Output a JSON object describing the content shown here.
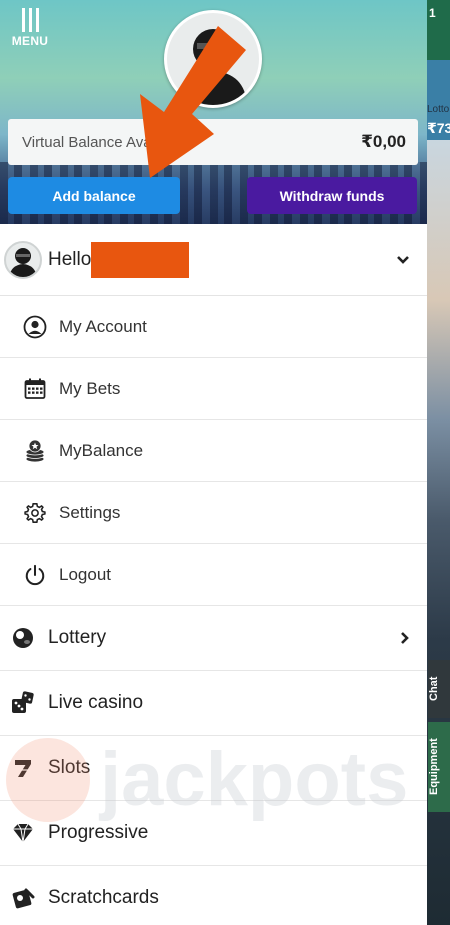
{
  "header": {
    "menu_label": "MENU",
    "balance_label": "Virtual Balance Available",
    "balance_value": "₹0,00",
    "add_balance": "Add balance",
    "withdraw_funds": "Withdraw funds"
  },
  "user": {
    "greeting": "Hello"
  },
  "account_menu": [
    {
      "label": "My Account",
      "icon": "user-circle-icon"
    },
    {
      "label": "My Bets",
      "icon": "calendar-icon"
    },
    {
      "label": "MyBalance",
      "icon": "coin-stack-icon"
    },
    {
      "label": "Settings",
      "icon": "gear-icon"
    },
    {
      "label": "Logout",
      "icon": "power-icon"
    }
  ],
  "main_menu": [
    {
      "label": "Lottery",
      "icon": "lottery-ball-icon",
      "has_chevron": true
    },
    {
      "label": "Live casino",
      "icon": "dice-icon",
      "has_chevron": false
    },
    {
      "label": "Slots",
      "icon": "seven-icon",
      "has_chevron": false
    },
    {
      "label": "Progressive",
      "icon": "gem-icon",
      "has_chevron": false
    },
    {
      "label": "Scratchcards",
      "icon": "scratchcard-icon",
      "has_chevron": false
    }
  ],
  "watermark": "jackpots",
  "background_app": {
    "lotto_label": "Lotto",
    "price_fragment": "₹73",
    "chat_label": "Chat",
    "equipment_label": "Equipment"
  },
  "colors": {
    "add_button": "#1e8be3",
    "withdraw_button": "#4a1aa0",
    "arrow": "#e8560f",
    "redaction": "#e8560f"
  }
}
